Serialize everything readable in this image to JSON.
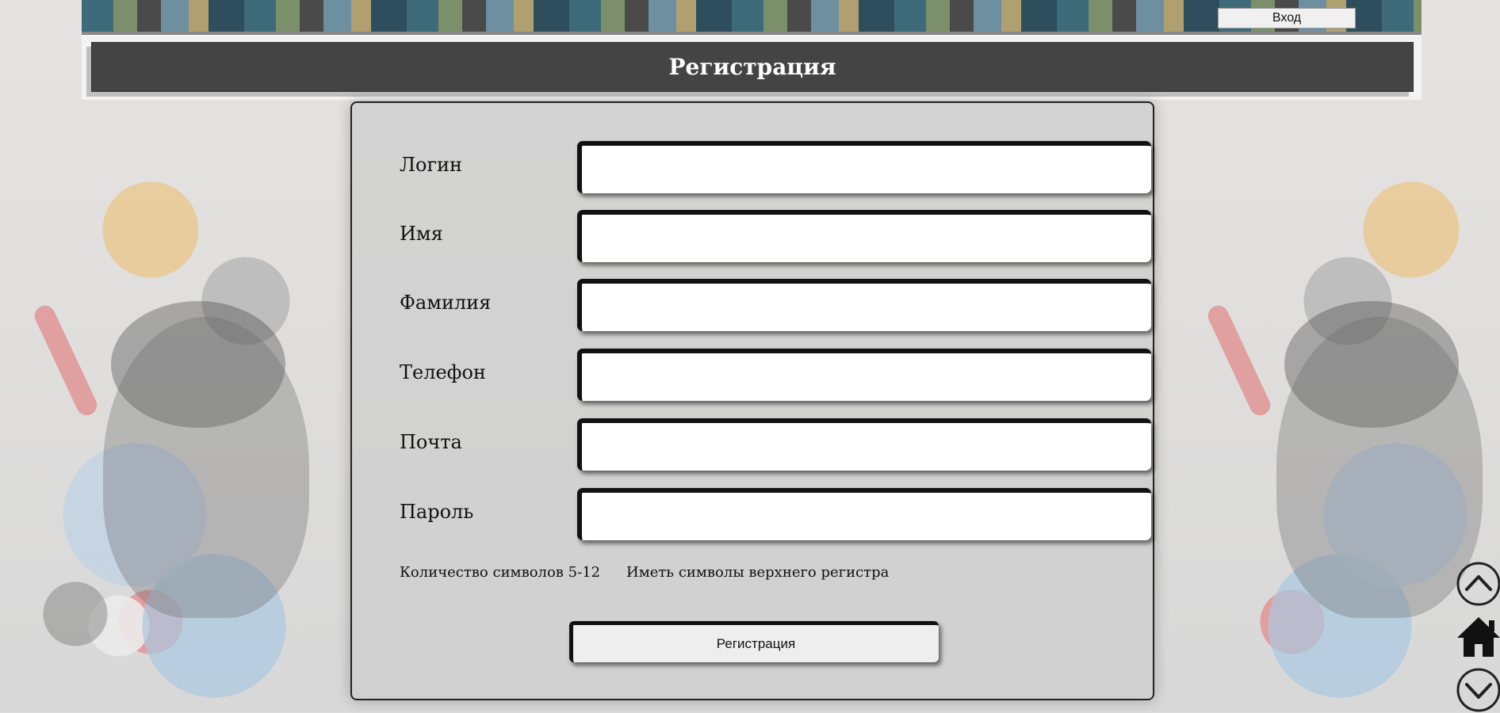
{
  "header": {
    "login_button": "Вход",
    "page_title": "Регистрация"
  },
  "form": {
    "fields": [
      {
        "label": "Логин",
        "value": ""
      },
      {
        "label": "Имя",
        "value": ""
      },
      {
        "label": "Фамилия",
        "value": ""
      },
      {
        "label": "Телефон",
        "value": ""
      },
      {
        "label": "Почта",
        "value": ""
      },
      {
        "label": "Пароль",
        "value": ""
      }
    ],
    "hints": [
      "Количество символов 5-12",
      "Иметь символы верхнего регистра"
    ],
    "submit_label": "Регистрация"
  },
  "side_nav": {
    "icons": [
      "chevron-up-icon",
      "home-icon",
      "chevron-down-icon"
    ]
  }
}
